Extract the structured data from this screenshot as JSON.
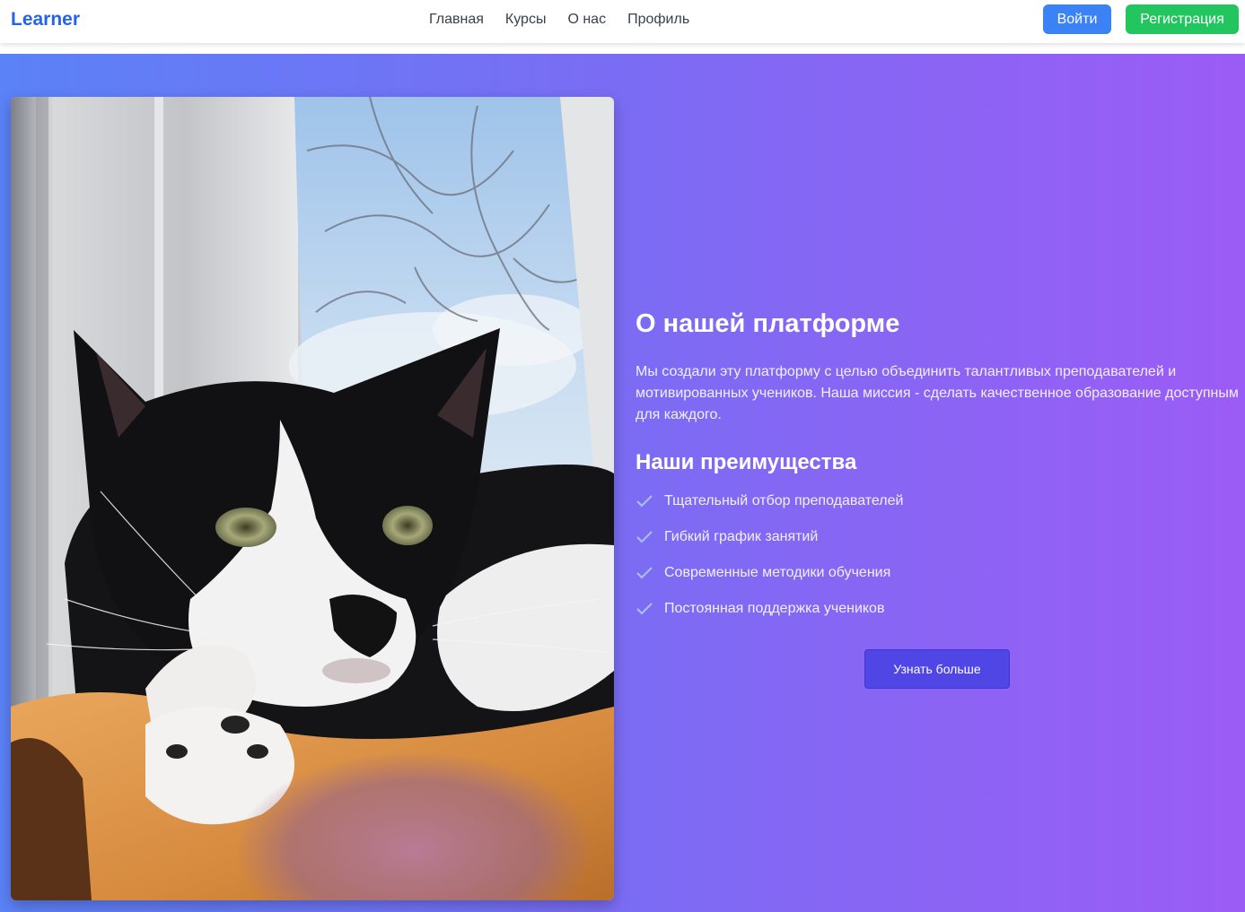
{
  "nav": {
    "logo": "Learner",
    "links": [
      "Главная",
      "Курсы",
      "О нас",
      "Профиль"
    ],
    "login_label": "Войти",
    "register_label": "Регистрация"
  },
  "colors": {
    "brand": "#2563eb",
    "login_button": "#3b82f6",
    "register_button": "#22c55e",
    "hero_gradient_start": "#5b82f7",
    "hero_gradient_end": "#9b5cf5",
    "cta_button": "#4f46e5"
  },
  "about": {
    "image_subject": "black-and-white cat lying by a window",
    "title": "О нашей платформе",
    "text": "Мы создали эту платформу с целью объединить талантливых преподавателей и мотивированных учеников. Наша миссия - сделать качественное образование доступным для каждого.",
    "advantages_title": "Наши преимущества",
    "advantages": [
      "Тщательный отбор преподавателей",
      "Гибкий график занятий",
      "Современные методики обучения",
      "Постоянная поддержка учеников"
    ],
    "advantage_icon": "check-icon",
    "more_label": "Узнать больше"
  }
}
